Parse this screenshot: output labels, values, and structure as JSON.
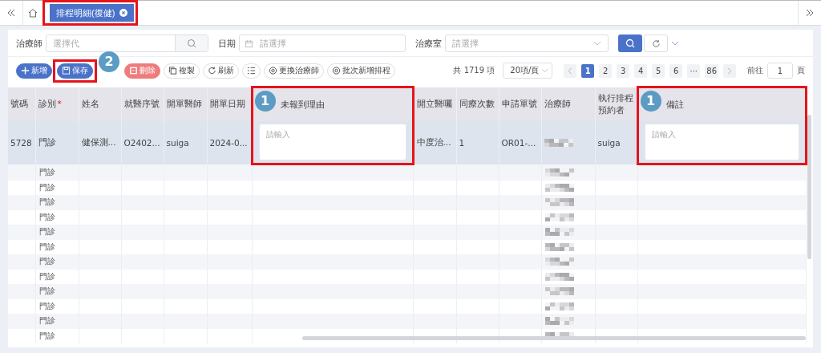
{
  "nav": {
    "tabs": [
      {
        "label": "排程明細(復健)",
        "selected": true,
        "highlighted": true
      }
    ]
  },
  "filters": [
    {
      "label": "治療師",
      "placeholder": "選擇代",
      "kind": "search"
    },
    {
      "label": "日期",
      "placeholder": "請選擇",
      "kind": "date"
    },
    {
      "label": "治療室",
      "placeholder": "請選擇",
      "kind": "select"
    }
  ],
  "toolbar": {
    "buttons": [
      {
        "label": "新增",
        "kind": "add"
      },
      {
        "label": "保存",
        "kind": "save",
        "highlighted": true,
        "badge": "2"
      },
      {
        "label": "刪除",
        "kind": "delete"
      },
      {
        "label": "複製",
        "kind": "copy"
      },
      {
        "label": "刷新",
        "kind": "refresh"
      },
      {
        "kind": "columns"
      },
      {
        "label": "更換治療師",
        "kind": "swap"
      },
      {
        "label": "批次新增排程",
        "kind": "batch"
      }
    ]
  },
  "pagination": {
    "total": "共 1719 項",
    "page_size": "20項/頁",
    "pages": [
      {
        "label": "1",
        "selected": true
      },
      {
        "label": "2",
        "selected": false
      },
      {
        "label": "3",
        "selected": false
      },
      {
        "label": "4",
        "selected": false
      },
      {
        "label": "5",
        "selected": false
      },
      {
        "label": "6",
        "selected": false
      },
      {
        "label": "···",
        "selected": false
      },
      {
        "label": "86",
        "selected": false
      }
    ],
    "goto_label": "前往",
    "goto_value": "1",
    "goto_suffix": "頁"
  },
  "table": {
    "columns": [
      {
        "label": "號碼"
      },
      {
        "label": "診別",
        "required_mark": "*"
      },
      {
        "label": "姓名"
      },
      {
        "label": "就醫序號"
      },
      {
        "label": "開單醫師"
      },
      {
        "label": "開單日期"
      },
      {
        "label": "未報到理由",
        "highlighted": true,
        "badge": "1"
      },
      {
        "label": "開立醫囑"
      },
      {
        "label": "同療次數"
      },
      {
        "label": "申請單號"
      },
      {
        "label": "治療師"
      },
      {
        "label": "執行排程預約者"
      },
      {
        "label": "備註",
        "highlighted": true,
        "badge": "1"
      }
    ],
    "rows": [
      {
        "selected": true,
        "cells": [
          {
            "kind": "text",
            "text": "5728"
          },
          {
            "kind": "text",
            "text": "門診"
          },
          {
            "kind": "text",
            "text": "健保測..."
          },
          {
            "kind": "text",
            "text": "O2402..."
          },
          {
            "kind": "text",
            "text": "suiga"
          },
          {
            "kind": "text",
            "text": "2024-0..."
          },
          {
            "kind": "input",
            "placeholder": "請輸入"
          },
          {
            "kind": "text",
            "text": "中度治..."
          },
          {
            "kind": "text",
            "text": "1"
          },
          {
            "kind": "text",
            "text": "OR01-..."
          },
          {
            "kind": "blurred"
          },
          {
            "kind": "text",
            "text": "suiga"
          },
          {
            "kind": "input",
            "placeholder": "請輸入"
          }
        ]
      },
      {
        "selected": false,
        "cells": [
          {
            "kind": "empty"
          },
          {
            "kind": "text",
            "text": "門診"
          },
          {
            "kind": "empty"
          },
          {
            "kind": "empty"
          },
          {
            "kind": "empty"
          },
          {
            "kind": "empty"
          },
          {
            "kind": "empty"
          },
          {
            "kind": "empty"
          },
          {
            "kind": "empty"
          },
          {
            "kind": "empty"
          },
          {
            "kind": "blurred"
          },
          {
            "kind": "empty"
          },
          {
            "kind": "empty"
          }
        ]
      },
      {
        "selected": false,
        "cells": [
          {
            "kind": "empty"
          },
          {
            "kind": "text",
            "text": "門診"
          },
          {
            "kind": "empty"
          },
          {
            "kind": "empty"
          },
          {
            "kind": "empty"
          },
          {
            "kind": "empty"
          },
          {
            "kind": "empty"
          },
          {
            "kind": "empty"
          },
          {
            "kind": "empty"
          },
          {
            "kind": "empty"
          },
          {
            "kind": "blurred"
          },
          {
            "kind": "empty"
          },
          {
            "kind": "empty"
          }
        ]
      },
      {
        "selected": false,
        "cells": [
          {
            "kind": "empty"
          },
          {
            "kind": "text",
            "text": "門診"
          },
          {
            "kind": "empty"
          },
          {
            "kind": "empty"
          },
          {
            "kind": "empty"
          },
          {
            "kind": "empty"
          },
          {
            "kind": "empty"
          },
          {
            "kind": "empty"
          },
          {
            "kind": "empty"
          },
          {
            "kind": "empty"
          },
          {
            "kind": "blurred"
          },
          {
            "kind": "empty"
          },
          {
            "kind": "empty"
          }
        ]
      },
      {
        "selected": false,
        "cells": [
          {
            "kind": "empty"
          },
          {
            "kind": "text",
            "text": "門診"
          },
          {
            "kind": "empty"
          },
          {
            "kind": "empty"
          },
          {
            "kind": "empty"
          },
          {
            "kind": "empty"
          },
          {
            "kind": "empty"
          },
          {
            "kind": "empty"
          },
          {
            "kind": "empty"
          },
          {
            "kind": "empty"
          },
          {
            "kind": "blurred"
          },
          {
            "kind": "empty"
          },
          {
            "kind": "empty"
          }
        ]
      },
      {
        "selected": false,
        "cells": [
          {
            "kind": "empty"
          },
          {
            "kind": "text",
            "text": "門診"
          },
          {
            "kind": "empty"
          },
          {
            "kind": "empty"
          },
          {
            "kind": "empty"
          },
          {
            "kind": "empty"
          },
          {
            "kind": "empty"
          },
          {
            "kind": "empty"
          },
          {
            "kind": "empty"
          },
          {
            "kind": "empty"
          },
          {
            "kind": "blurred"
          },
          {
            "kind": "empty"
          },
          {
            "kind": "empty"
          }
        ]
      },
      {
        "selected": false,
        "cells": [
          {
            "kind": "empty"
          },
          {
            "kind": "text",
            "text": "門診"
          },
          {
            "kind": "empty"
          },
          {
            "kind": "empty"
          },
          {
            "kind": "empty"
          },
          {
            "kind": "empty"
          },
          {
            "kind": "empty"
          },
          {
            "kind": "empty"
          },
          {
            "kind": "empty"
          },
          {
            "kind": "empty"
          },
          {
            "kind": "blurred"
          },
          {
            "kind": "empty"
          },
          {
            "kind": "empty"
          }
        ]
      },
      {
        "selected": false,
        "cells": [
          {
            "kind": "empty"
          },
          {
            "kind": "text",
            "text": "門診"
          },
          {
            "kind": "empty"
          },
          {
            "kind": "empty"
          },
          {
            "kind": "empty"
          },
          {
            "kind": "empty"
          },
          {
            "kind": "empty"
          },
          {
            "kind": "empty"
          },
          {
            "kind": "empty"
          },
          {
            "kind": "empty"
          },
          {
            "kind": "blurred"
          },
          {
            "kind": "empty"
          },
          {
            "kind": "empty"
          }
        ]
      },
      {
        "selected": false,
        "cells": [
          {
            "kind": "empty"
          },
          {
            "kind": "text",
            "text": "門診"
          },
          {
            "kind": "empty"
          },
          {
            "kind": "empty"
          },
          {
            "kind": "empty"
          },
          {
            "kind": "empty"
          },
          {
            "kind": "empty"
          },
          {
            "kind": "empty"
          },
          {
            "kind": "empty"
          },
          {
            "kind": "empty"
          },
          {
            "kind": "blurred"
          },
          {
            "kind": "empty"
          },
          {
            "kind": "empty"
          }
        ]
      },
      {
        "selected": false,
        "cells": [
          {
            "kind": "empty"
          },
          {
            "kind": "text",
            "text": "門診"
          },
          {
            "kind": "empty"
          },
          {
            "kind": "empty"
          },
          {
            "kind": "empty"
          },
          {
            "kind": "empty"
          },
          {
            "kind": "empty"
          },
          {
            "kind": "empty"
          },
          {
            "kind": "empty"
          },
          {
            "kind": "empty"
          },
          {
            "kind": "blurred"
          },
          {
            "kind": "empty"
          },
          {
            "kind": "empty"
          }
        ]
      },
      {
        "selected": false,
        "cells": [
          {
            "kind": "empty"
          },
          {
            "kind": "text",
            "text": "門診"
          },
          {
            "kind": "empty"
          },
          {
            "kind": "empty"
          },
          {
            "kind": "empty"
          },
          {
            "kind": "empty"
          },
          {
            "kind": "empty"
          },
          {
            "kind": "empty"
          },
          {
            "kind": "empty"
          },
          {
            "kind": "empty"
          },
          {
            "kind": "blurred"
          },
          {
            "kind": "empty"
          },
          {
            "kind": "empty"
          }
        ]
      },
      {
        "selected": false,
        "cells": [
          {
            "kind": "empty"
          },
          {
            "kind": "text",
            "text": "門診"
          },
          {
            "kind": "empty"
          },
          {
            "kind": "empty"
          },
          {
            "kind": "empty"
          },
          {
            "kind": "empty"
          },
          {
            "kind": "empty"
          },
          {
            "kind": "empty"
          },
          {
            "kind": "empty"
          },
          {
            "kind": "empty"
          },
          {
            "kind": "blurred"
          },
          {
            "kind": "empty"
          },
          {
            "kind": "empty"
          }
        ]
      },
      {
        "selected": false,
        "cells": [
          {
            "kind": "empty"
          },
          {
            "kind": "text",
            "text": "門診"
          },
          {
            "kind": "empty"
          },
          {
            "kind": "empty"
          },
          {
            "kind": "empty"
          },
          {
            "kind": "empty"
          },
          {
            "kind": "empty"
          },
          {
            "kind": "empty"
          },
          {
            "kind": "empty"
          },
          {
            "kind": "empty"
          },
          {
            "kind": "blurred"
          },
          {
            "kind": "empty"
          },
          {
            "kind": "empty"
          }
        ]
      }
    ]
  }
}
